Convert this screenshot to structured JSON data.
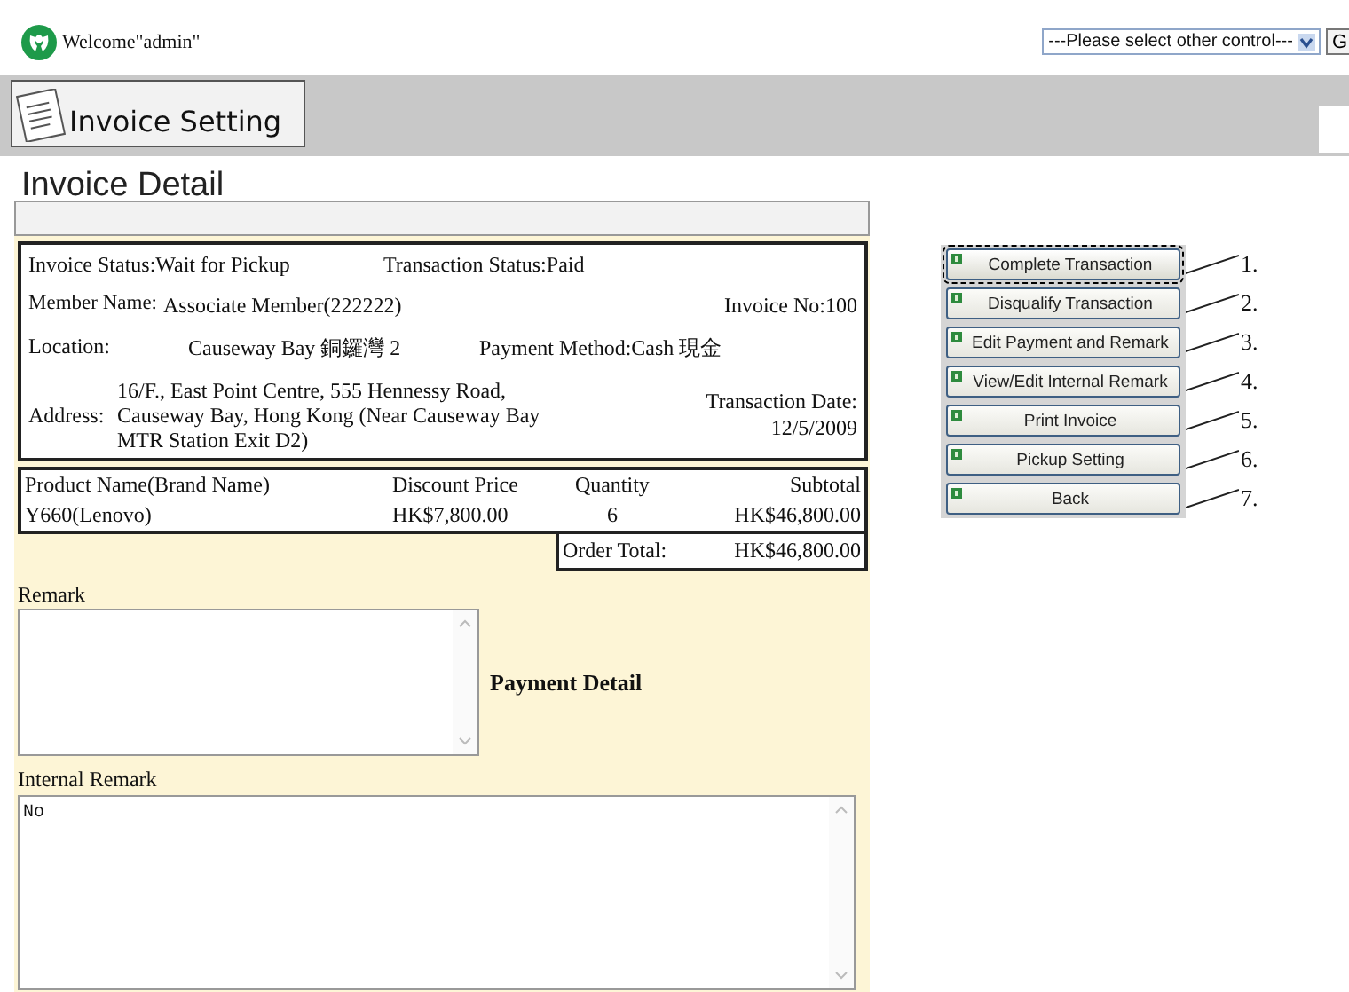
{
  "header": {
    "welcome": "Welcome\"admin\"",
    "control_select": {
      "value": "---Please select other control---"
    },
    "go_button": "G"
  },
  "page_title": "Invoice Setting",
  "section_title": "Invoice Detail",
  "invoice": {
    "invoice_status": "Invoice Status:Wait for Pickup",
    "transaction_status": "Transaction Status:Paid",
    "member_label": "Member Name:",
    "member_value": "Associate Member(222222)",
    "invoice_no": "Invoice No:100",
    "location_label": "Location:",
    "location_value": "Causeway Bay 銅鑼灣 2",
    "payment_method": "Payment Method:Cash 現金",
    "address_label": "Address:",
    "address_value": "16/F., East Point Centre, 555 Hennessy Road, Causeway Bay, Hong Kong (Near Causeway Bay MTR Station Exit D2)",
    "transaction_date_label": "Transaction Date:",
    "transaction_date_value": "12/5/2009"
  },
  "products": {
    "columns": [
      "Product Name(Brand Name)",
      "Discount Price",
      "Quantity",
      "Subtotal"
    ],
    "rows": [
      [
        "Y660(Lenovo)",
        "HK$7,800.00",
        "6",
        "HK$46,800.00"
      ]
    ]
  },
  "order_total": {
    "label": "Order Total:",
    "value": "HK$46,800.00"
  },
  "remark": {
    "label": "Remark"
  },
  "payment_detail": "Payment Detail",
  "internal_remark": {
    "label": "Internal Remark",
    "value": "No"
  },
  "actions": [
    {
      "label": "Complete Transaction",
      "callout": "1.",
      "focused": true
    },
    {
      "label": "Disqualify Transaction",
      "callout": "2.",
      "focused": false
    },
    {
      "label": "Edit Payment and Remark",
      "callout": "3.",
      "focused": false
    },
    {
      "label": "View/Edit Internal Remark",
      "callout": "4.",
      "focused": false
    },
    {
      "label": "Print Invoice",
      "callout": "5.",
      "focused": false
    },
    {
      "label": "Pickup Setting",
      "callout": "6.",
      "focused": false
    },
    {
      "label": "Back",
      "callout": "7.",
      "focused": false
    }
  ]
}
